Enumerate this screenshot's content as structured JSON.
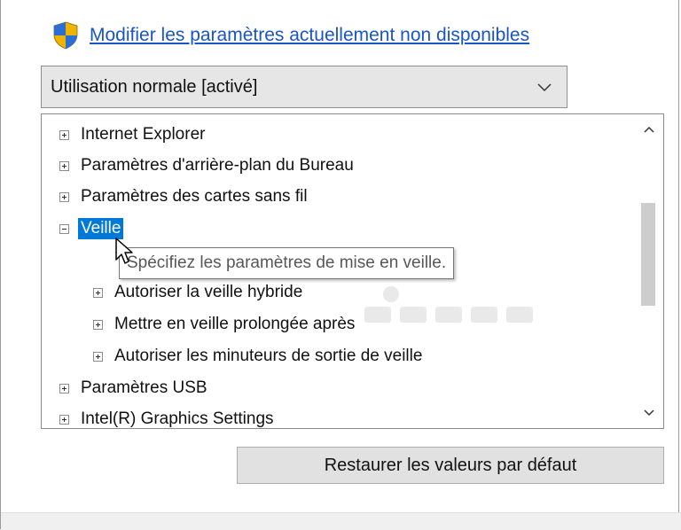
{
  "link": {
    "text": "Modifier les paramètres actuellement non disponibles",
    "color": "#1a55c4",
    "icon": "uac-shield-icon"
  },
  "plan_select": {
    "selected": "Utilisation normale [activé]"
  },
  "tree": {
    "items": [
      {
        "label": "Internet Explorer",
        "expanded": false,
        "level": 0
      },
      {
        "label": "Paramètres d'arrière-plan du Bureau",
        "expanded": false,
        "level": 0
      },
      {
        "label": "Paramètres des cartes sans fil",
        "expanded": false,
        "level": 0
      },
      {
        "label": "Veille",
        "expanded": true,
        "level": 0,
        "selected": true
      },
      {
        "label": "Autoriser la veille hybride",
        "expanded": false,
        "level": 1
      },
      {
        "label": "Mettre en veille prolongée après",
        "expanded": false,
        "level": 1
      },
      {
        "label": "Autoriser les minuteurs de sortie de veille",
        "expanded": false,
        "level": 1
      },
      {
        "label": "Paramètres USB",
        "expanded": false,
        "level": 0
      },
      {
        "label": "Intel(R) Graphics Settings",
        "expanded": false,
        "level": 0
      }
    ],
    "selection_color": "#0078d7"
  },
  "tooltip": {
    "text": "Spécifiez les paramètres de mise en veille."
  },
  "restore_button": {
    "label": "Restaurer les valeurs par défaut"
  }
}
